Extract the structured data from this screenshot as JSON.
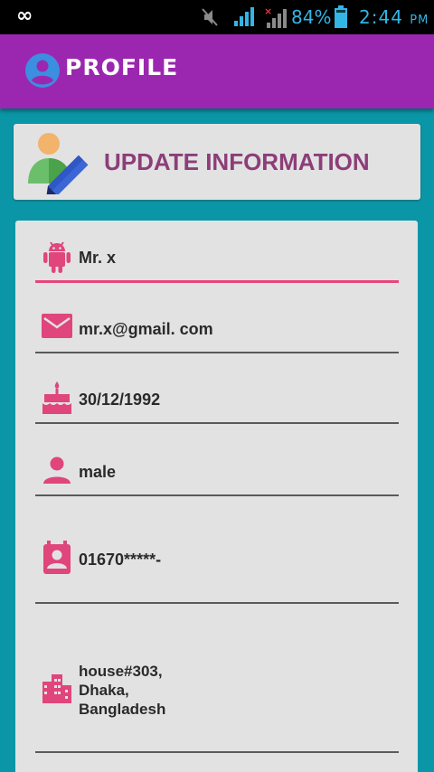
{
  "status_bar": {
    "battery_percent": "84%",
    "time": "2:44",
    "ampm": "PM"
  },
  "app_bar": {
    "title": "PROFILE"
  },
  "banner": {
    "title": "UPDATE INFORMATION"
  },
  "form": {
    "name": "Mr. x",
    "email": "mr.x@gmail. com",
    "birthday": "30/12/1992",
    "gender": "male",
    "phone": "01670*****-",
    "address": "house#303,\nDhaka,\nBangladesh"
  },
  "colors": {
    "status_bar": "#000000",
    "app_bar": "#9b27b0",
    "background": "#0a96a6",
    "card": "#e2e2e2",
    "accent_icon": "#e0457b",
    "banner_title": "#8c3e78"
  },
  "icons": {
    "name": "android-icon",
    "email": "mail-icon",
    "birthday": "cake-icon",
    "gender": "person-icon",
    "phone": "contact-card-icon",
    "address": "city-icon"
  }
}
